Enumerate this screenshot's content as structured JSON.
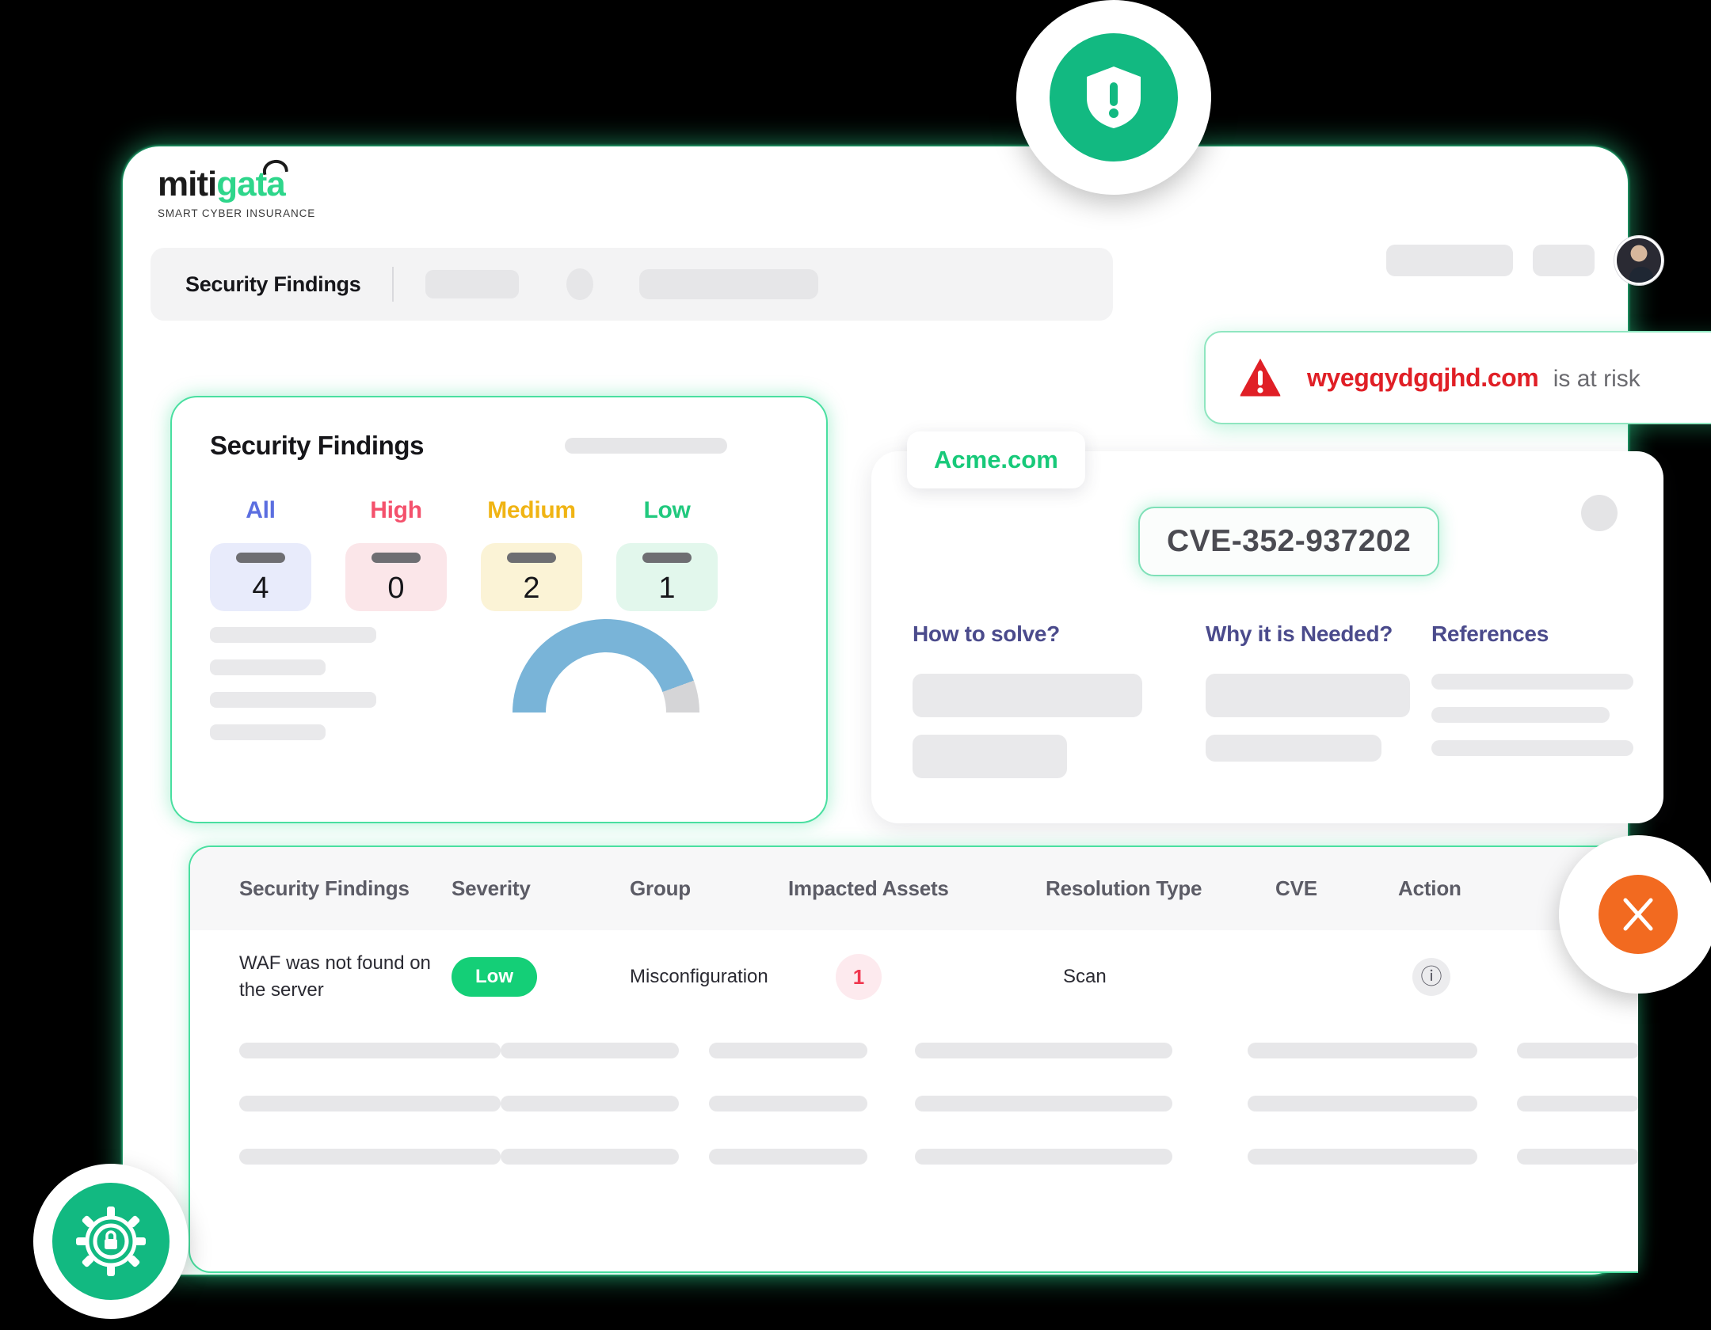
{
  "brand": {
    "name_part_dark": "miti",
    "name_part_green": "gata",
    "tagline": "SMART CYBER INSURANCE"
  },
  "breadcrumb": {
    "title": "Security Findings"
  },
  "findings_card": {
    "title": "Security Findings",
    "severities": [
      {
        "label": "All",
        "count": "4",
        "color": "#5b6ee0",
        "bg": "#e8ebfb"
      },
      {
        "label": "High",
        "count": "0",
        "color": "#f4516c",
        "bg": "#fbe6e9"
      },
      {
        "label": "Medium",
        "count": "2",
        "color": "#f0b414",
        "bg": "#fbf3d6"
      },
      {
        "label": "Low",
        "count": "1",
        "color": "#21c97e",
        "bg": "#e2f7ec"
      }
    ]
  },
  "alert": {
    "icon": "warning-triangle-icon",
    "domain": "wyegqydgqjhd.com",
    "suffix": "is at risk",
    "domain_color": "#e01f26"
  },
  "detail_panel": {
    "company": "Acme.com",
    "cve_id": "CVE-352-937202",
    "tabs": [
      {
        "label": "How to solve?"
      },
      {
        "label": "Why it is Needed?"
      },
      {
        "label": "References"
      }
    ]
  },
  "table": {
    "columns": [
      "Security Findings",
      "Severity",
      "Group",
      "Impacted Assets",
      "Resolution Type",
      "CVE",
      "Action"
    ],
    "rows": [
      {
        "finding": "WAF was not found on the server",
        "severity": "Low",
        "severity_color": "#14cf77",
        "group": "Misconfiguration",
        "impacted_assets": "1",
        "resolution_type": "Scan",
        "cve": "",
        "action_icon": "info-circle-icon"
      }
    ],
    "placeholder_row_count": 3
  },
  "floating_badges": [
    {
      "name": "shield-badge",
      "icon": "shield-icon",
      "color": "#12b981"
    },
    {
      "name": "gear-badge",
      "icon": "gear-lock-icon",
      "color": "#12b981"
    },
    {
      "name": "swords-badge",
      "icon": "crossed-swords-icon",
      "color": "#f26a20"
    }
  ]
}
